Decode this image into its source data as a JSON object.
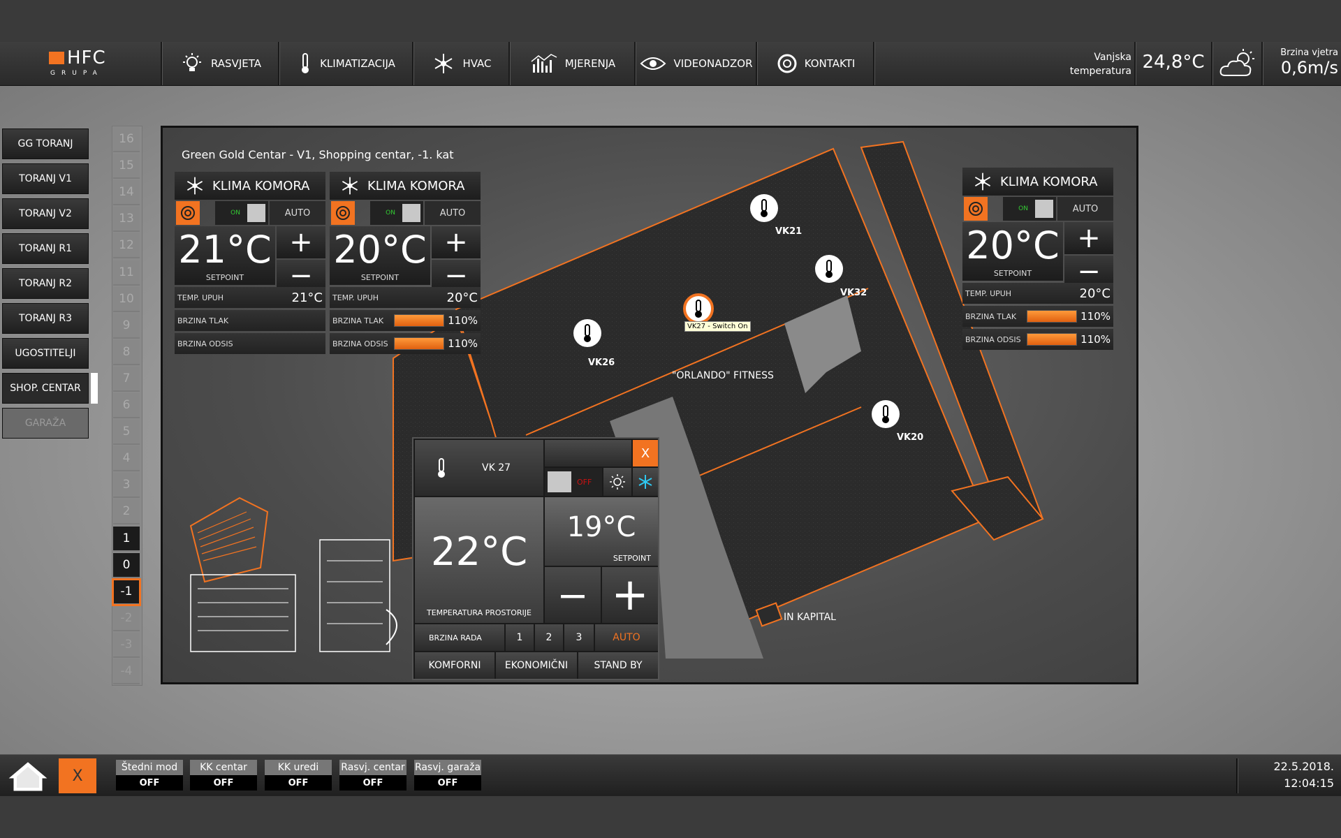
{
  "brand": {
    "logo": "HFC",
    "sub": "GRUPA"
  },
  "nav": [
    {
      "label": "RASVJETA",
      "icon": "light-icon"
    },
    {
      "label": "KLIMATIZACIJA",
      "icon": "thermometer-icon"
    },
    {
      "label": "HVAC",
      "icon": "fan-icon"
    },
    {
      "label": "MJERENJA",
      "icon": "chart-icon"
    },
    {
      "label": "VIDEONADZOR",
      "icon": "eye-icon"
    },
    {
      "label": "KONTAKTI",
      "icon": "lifebuoy-icon"
    }
  ],
  "weather": {
    "outside_label": "Vanjska temperatura",
    "outside_temp": "24,8°C",
    "wind_label": "Brzina vjetra",
    "wind_value": "0,6m/s",
    "icon": "cloud-sun-icon"
  },
  "left_menu": [
    "GG TORANJ",
    "TORANJ V1",
    "TORANJ V2",
    "TORANJ R1",
    "TORANJ R2",
    "TORANJ R3",
    "UGOSTITELJI",
    "SHOP. CENTAR",
    "GARAŽA"
  ],
  "left_menu_active": "SHOP. CENTAR",
  "floors": [
    "16",
    "15",
    "14",
    "13",
    "12",
    "11",
    "10",
    "9",
    "8",
    "7",
    "6",
    "5",
    "4",
    "3",
    "2",
    "1",
    "0",
    "-1",
    "-2",
    "-3",
    "-4"
  ],
  "floor_selected": "-1",
  "map": {
    "title": "Green Gold Centar - V1, Shopping centar, -1. kat",
    "zone_fitness": "\"ORLANDO\" FITNESS",
    "zone_kapital": "IN KAPITAL",
    "sensors": [
      "VK21",
      "VK32",
      "VK26",
      "VK20",
      "VK27"
    ],
    "tooltip": "VK27 - Switch On"
  },
  "cards": [
    {
      "title": "KLIMA KOMORA",
      "toggle": "ON",
      "mode": "AUTO",
      "setpoint": "21°C",
      "setpoint_label": "SETPOINT",
      "plus": "+",
      "minus": "−",
      "upuh_label": "TEMP. UPUH",
      "upuh": "21°C",
      "tlak_label": "BRZINA TLAK",
      "tlak": "",
      "odsis_label": "BRZINA ODSIS",
      "odsis": ""
    },
    {
      "title": "KLIMA KOMORA",
      "toggle": "ON",
      "mode": "AUTO",
      "setpoint": "20°C",
      "setpoint_label": "SETPOINT",
      "plus": "+",
      "minus": "−",
      "upuh_label": "TEMP. UPUH",
      "upuh": "20°C",
      "tlak_label": "BRZINA TLAK",
      "tlak": "110%",
      "odsis_label": "BRZINA ODSIS",
      "odsis": "110%"
    },
    {
      "title": "KLIMA KOMORA",
      "toggle": "ON",
      "mode": "AUTO",
      "setpoint": "20°C",
      "setpoint_label": "SETPOINT",
      "plus": "+",
      "minus": "−",
      "upuh_label": "TEMP. UPUH",
      "upuh": "20°C",
      "tlak_label": "BRZINA TLAK",
      "tlak": "110%",
      "odsis_label": "BRZINA ODSIS",
      "odsis": "110%"
    }
  ],
  "thermostat": {
    "name": "VK 27",
    "close": "X",
    "power": "OFF",
    "room_temp": "22°C",
    "room_label": "TEMPERATURA PROSTORIJE",
    "setpoint": "19°C",
    "setpoint_label": "SETPOINT",
    "minus": "−",
    "plus": "+",
    "speed_label": "BRZINA RADA",
    "speeds": [
      "1",
      "2",
      "3"
    ],
    "speed_auto": "AUTO",
    "modes": [
      "KOMFORNI",
      "EKONOMIČNI",
      "STAND BY"
    ]
  },
  "bottom": {
    "close": "X",
    "buttons": [
      {
        "label": "Štedni mod",
        "state": "OFF"
      },
      {
        "label": "KK centar",
        "state": "OFF"
      },
      {
        "label": "KK uredi",
        "state": "OFF"
      },
      {
        "label": "Rasvj. centar",
        "state": "OFF"
      },
      {
        "label": "Rasvj. garaža",
        "state": "OFF"
      }
    ],
    "date": "22.5.2018.",
    "time": "12:04:15"
  },
  "colors": {
    "accent": "#f27321",
    "panel": "#1f1f1f"
  }
}
